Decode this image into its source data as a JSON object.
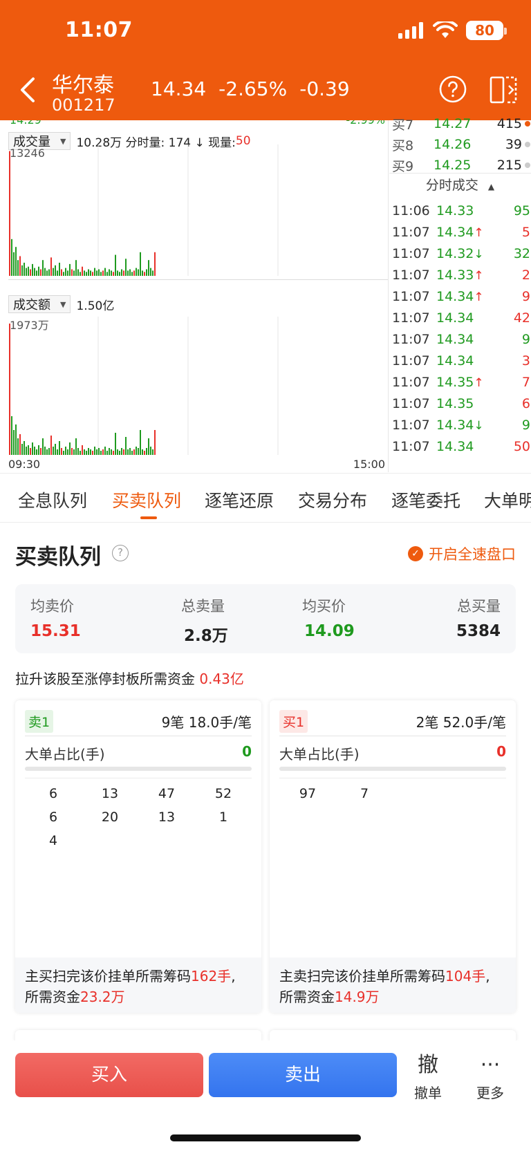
{
  "status": {
    "time": "11:07",
    "battery": "80"
  },
  "header": {
    "name": "华尔泰",
    "code": "001217",
    "price": "14.34",
    "pct": "-2.65%",
    "change": "-0.39"
  },
  "chart": {
    "top_left_cut": "14.29",
    "top_right_cut": "-2.99%",
    "volume": {
      "selector": "成交量",
      "summary": "10.28万 分时量: 174 ↓ 现量: ",
      "current": "50",
      "max_label": "13246"
    },
    "amount": {
      "selector": "成交额",
      "summary": "1.50亿",
      "max_label": "1973万"
    },
    "time_start": "09:30",
    "time_end": "15:00"
  },
  "orderbook": [
    {
      "label": "买7",
      "price": "14.27",
      "vol": "415",
      "dot": "orange"
    },
    {
      "label": "买8",
      "price": "14.26",
      "vol": "39",
      "dot": "gray"
    },
    {
      "label": "买9",
      "price": "14.25",
      "vol": "215",
      "dot": "gray"
    }
  ],
  "trades_title": "分时成交",
  "trades": [
    {
      "time": "11:06",
      "price": "14.33",
      "arrow": "",
      "vol": "95",
      "color": "green"
    },
    {
      "time": "11:07",
      "price": "14.34",
      "arrow": "↑",
      "vol": "5",
      "color": "red"
    },
    {
      "time": "11:07",
      "price": "14.32",
      "arrow": "↓",
      "vol": "32",
      "color": "green"
    },
    {
      "time": "11:07",
      "price": "14.33",
      "arrow": "↑",
      "vol": "2",
      "color": "red"
    },
    {
      "time": "11:07",
      "price": "14.34",
      "arrow": "↑",
      "vol": "9",
      "color": "red"
    },
    {
      "time": "11:07",
      "price": "14.34",
      "arrow": "",
      "vol": "42",
      "color": "red"
    },
    {
      "time": "11:07",
      "price": "14.34",
      "arrow": "",
      "vol": "9",
      "color": "green"
    },
    {
      "time": "11:07",
      "price": "14.34",
      "arrow": "",
      "vol": "3",
      "color": "red"
    },
    {
      "time": "11:07",
      "price": "14.35",
      "arrow": "↑",
      "vol": "7",
      "color": "red"
    },
    {
      "time": "11:07",
      "price": "14.35",
      "arrow": "",
      "vol": "6",
      "color": "red"
    },
    {
      "time": "11:07",
      "price": "14.34",
      "arrow": "↓",
      "vol": "9",
      "color": "green"
    },
    {
      "time": "11:07",
      "price": "14.34",
      "arrow": "",
      "vol": "50",
      "color": "red"
    }
  ],
  "tabs": [
    "全息队列",
    "买卖队列",
    "逐笔还原",
    "交易分布",
    "逐笔委托",
    "大单明"
  ],
  "active_tab": 1,
  "section": {
    "title": "买卖队列",
    "help": "?",
    "fast_link": "开启全速盘口"
  },
  "summary": {
    "avg_sell_label": "均卖价",
    "avg_sell": "15.31",
    "total_sell_label": "总卖量",
    "total_sell": "2.8万",
    "avg_buy_label": "均买价",
    "avg_buy": "14.09",
    "total_buy_label": "总买量",
    "total_buy": "5384"
  },
  "need": {
    "text": "拉升该股至涨停封板所需资金",
    "value": "0.43亿"
  },
  "sell_card": {
    "tag": "卖1",
    "info": "9笔   18.0手/笔",
    "big_label": "大单占比(手)",
    "big_value": "0",
    "queue": [
      "6",
      "13",
      "47",
      "52",
      "6",
      "20",
      "13",
      "1",
      "4"
    ],
    "foot_prefix": "主买扫完该价挂单所需筹码",
    "foot_qty": "162手",
    "foot_mid": "所需资金",
    "foot_amt": "23.2万"
  },
  "buy_card": {
    "tag": "买1",
    "info": "2笔   52.0手/笔",
    "big_label": "大单占比(手)",
    "big_value": "0",
    "queue": [
      "97",
      "7"
    ],
    "foot_prefix": "主卖扫完该价挂单所需筹码",
    "foot_qty": "104手",
    "foot_mid": "所需资金",
    "foot_amt": "14.9万"
  },
  "bottom": {
    "buy": "买入",
    "sell": "卖出",
    "cancel_glyph": "撤",
    "cancel": "撤单",
    "more_glyph": "···",
    "more": "更多"
  },
  "colors": {
    "brand": "#ee5a0e",
    "up": "#e8302a",
    "down": "#1f9a1f",
    "sell_btn": "#3474ee"
  }
}
